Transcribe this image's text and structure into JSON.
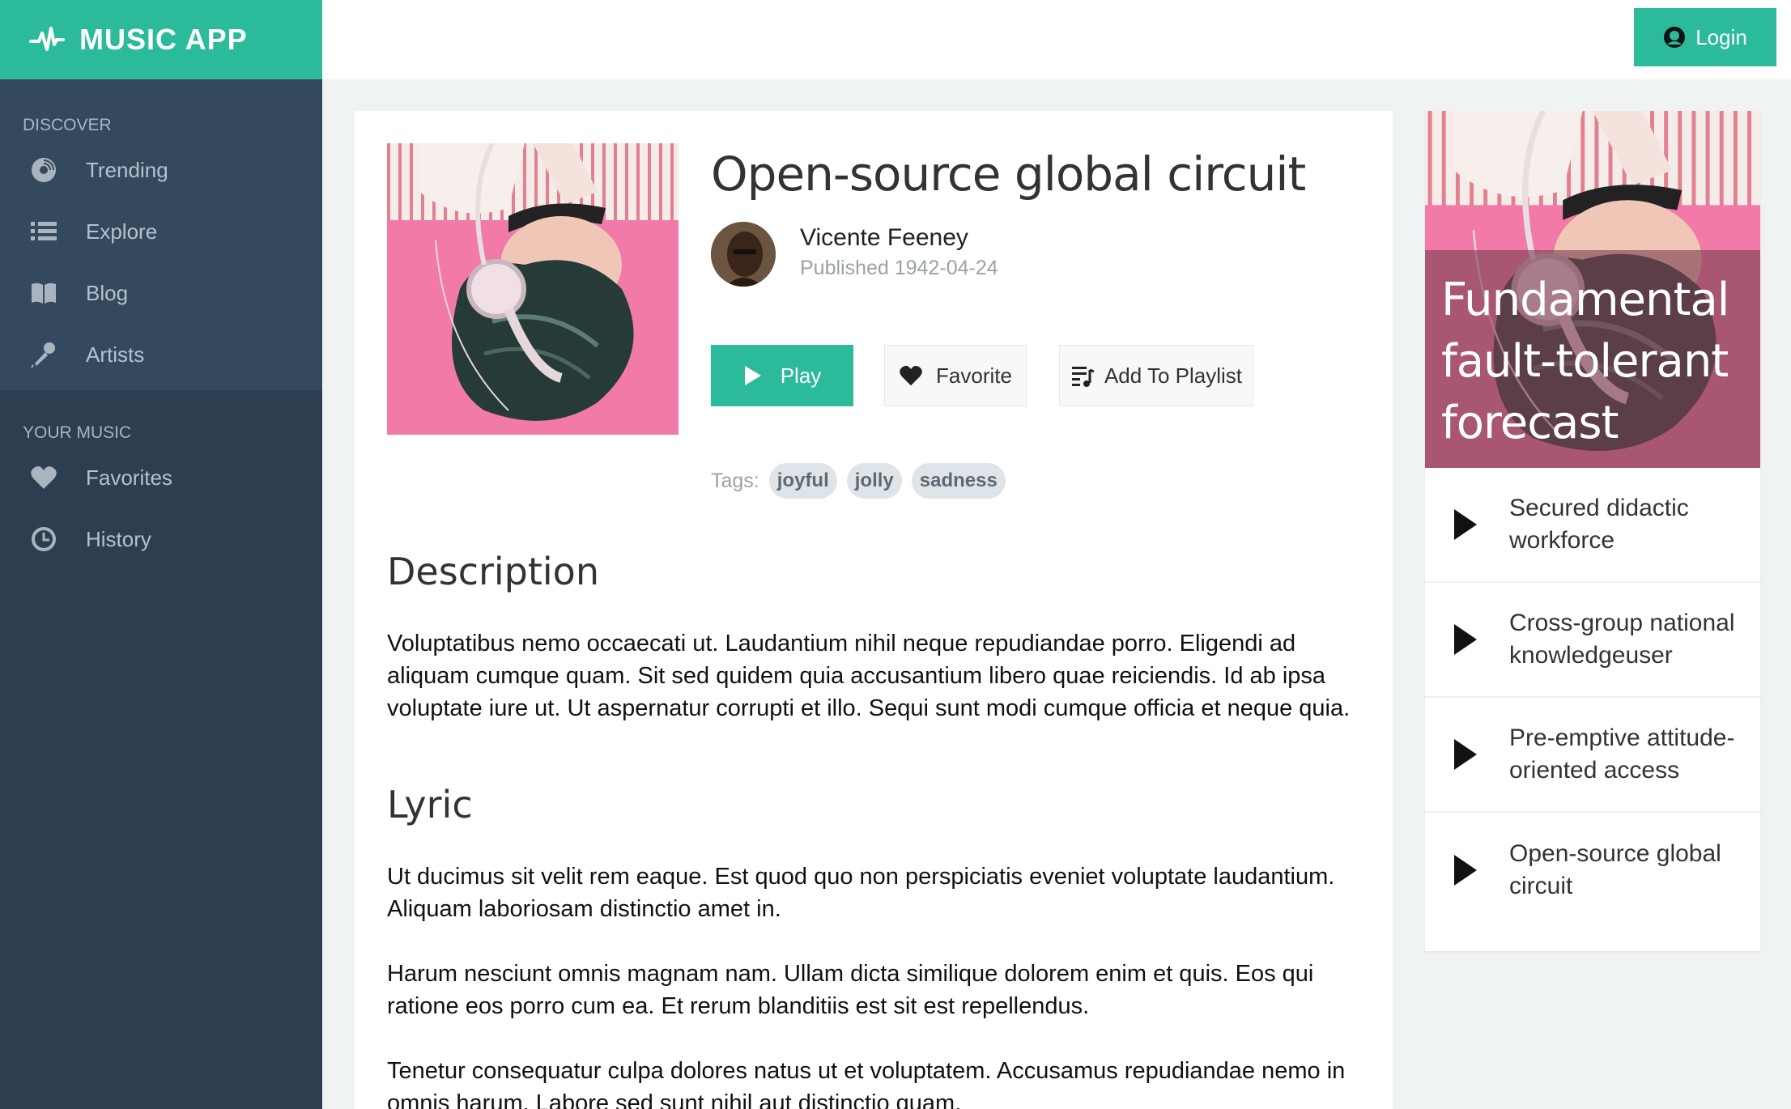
{
  "brand": {
    "name": "MUSIC APP",
    "icon": "pulse-icon"
  },
  "sidebar": {
    "discover_label": "DISCOVER",
    "discover_items": [
      {
        "label": "Trending",
        "icon": "disc-icon"
      },
      {
        "label": "Explore",
        "icon": "list-icon"
      },
      {
        "label": "Blog",
        "icon": "book-icon"
      },
      {
        "label": "Artists",
        "icon": "microphone-icon"
      }
    ],
    "your_music_label": "YOUR MUSIC",
    "your_music_items": [
      {
        "label": "Favorites",
        "icon": "heart-icon"
      },
      {
        "label": "History",
        "icon": "clock-icon"
      }
    ]
  },
  "header": {
    "login_label": "Login"
  },
  "song": {
    "title": "Open-source global circuit",
    "author": "Vicente Feeney",
    "published": "Published 1942-04-24",
    "play_label": "Play",
    "favorite_label": "Favorite",
    "add_label": "Add To Playlist",
    "tags_label": "Tags:",
    "tags": [
      "joyful",
      "jolly",
      "sadness"
    ],
    "description_heading": "Description",
    "description": "Voluptatibus nemo occaecati ut. Laudantium nihil neque repudiandae porro. Eligendi ad aliquam cumque quam. Sit sed quidem quia accusantium libero quae reiciendis. Id ab ipsa voluptate iure ut. Ut aspernatur corrupti et illo. Sequi sunt modi cumque officia et neque quia.",
    "lyric_heading": "Lyric",
    "lyric": [
      "Ut ducimus sit velit rem eaque. Est quod quo non perspiciatis eveniet voluptate laudantium. Aliquam laboriosam distinctio amet in.",
      "Harum nesciunt omnis magnam nam. Ullam dicta similique dolorem enim et quis. Eos qui ratione eos porro cum ea. Et rerum blanditiis est sit est repellendus.",
      "Tenetur consequatur culpa dolores natus ut et voluptatem. Accusamus repudiandae nemo in omnis harum. Labore sed sunt nihil aut distinctio quam."
    ]
  },
  "featured": {
    "title": "Fundamental fault-tolerant forecast",
    "tracks": [
      "Secured didactic workforce",
      "Cross-group national knowledgeuser",
      "Pre-emptive attitude-oriented access",
      "Open-source global circuit"
    ]
  },
  "colors": {
    "accent": "#2bbb9b",
    "sidebar": "#2c3e50",
    "sidebar_top": "#34495e",
    "background": "#f0f3f4"
  }
}
